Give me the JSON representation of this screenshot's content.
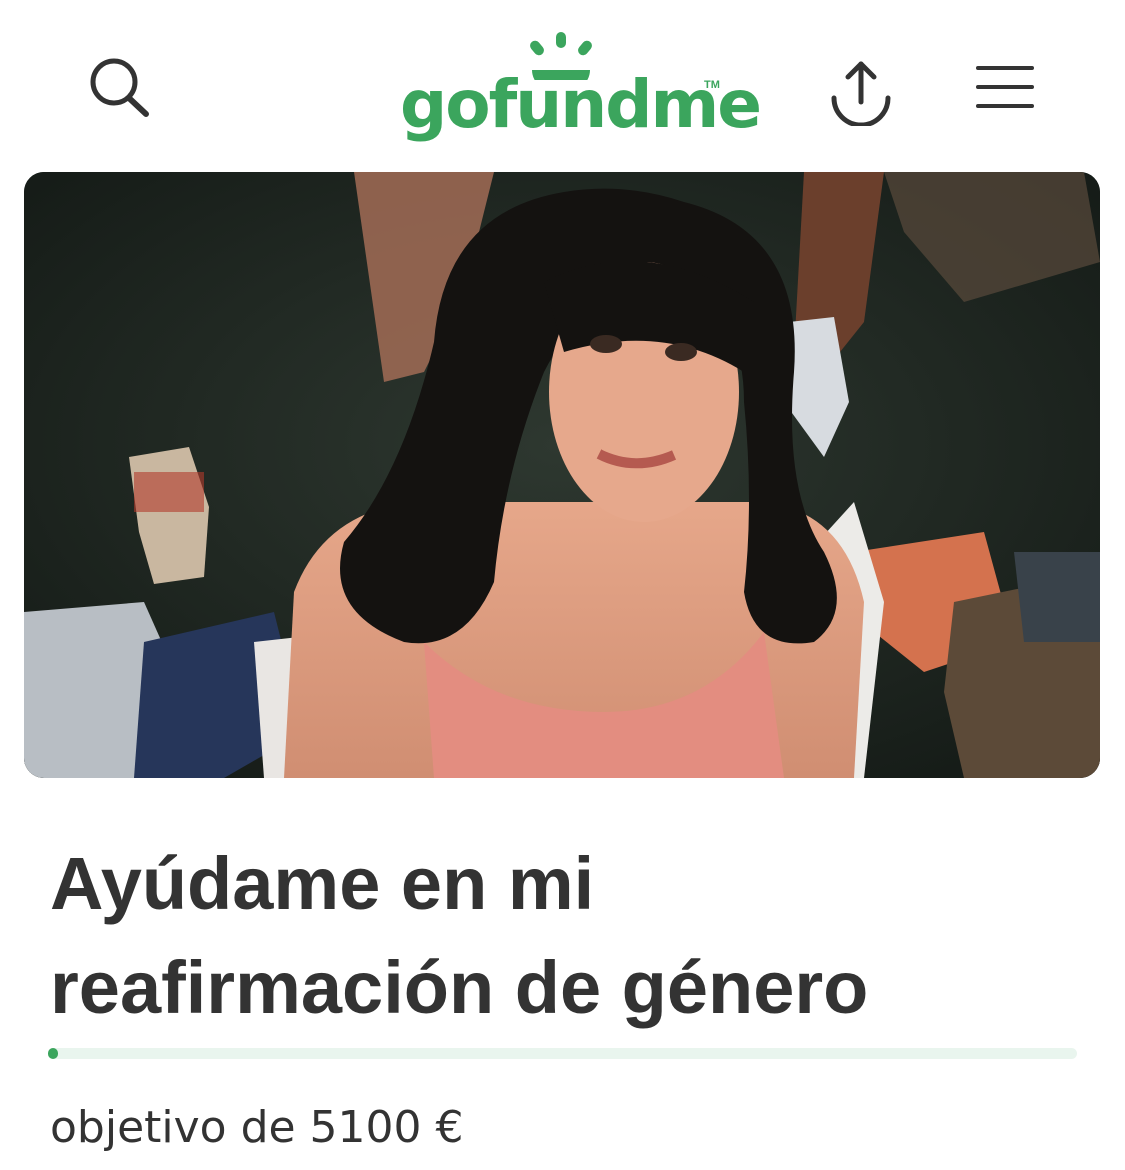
{
  "header": {
    "logo_text": "gofundme",
    "logo_tm": "TM",
    "search_icon": "search-icon",
    "share_icon": "share-upload-icon",
    "menu_icon": "hamburger-menu-icon"
  },
  "hero_image": {
    "description_icon": "campaign-photo"
  },
  "campaign": {
    "title": "Ayúdame en mi reafirmación de género",
    "goal_text": "objetivo de 5100 €",
    "progress_fraction": 0.008
  },
  "colors": {
    "brand_green": "#3ba55d",
    "progress_track": "#e9f5ee",
    "text": "#333333"
  }
}
